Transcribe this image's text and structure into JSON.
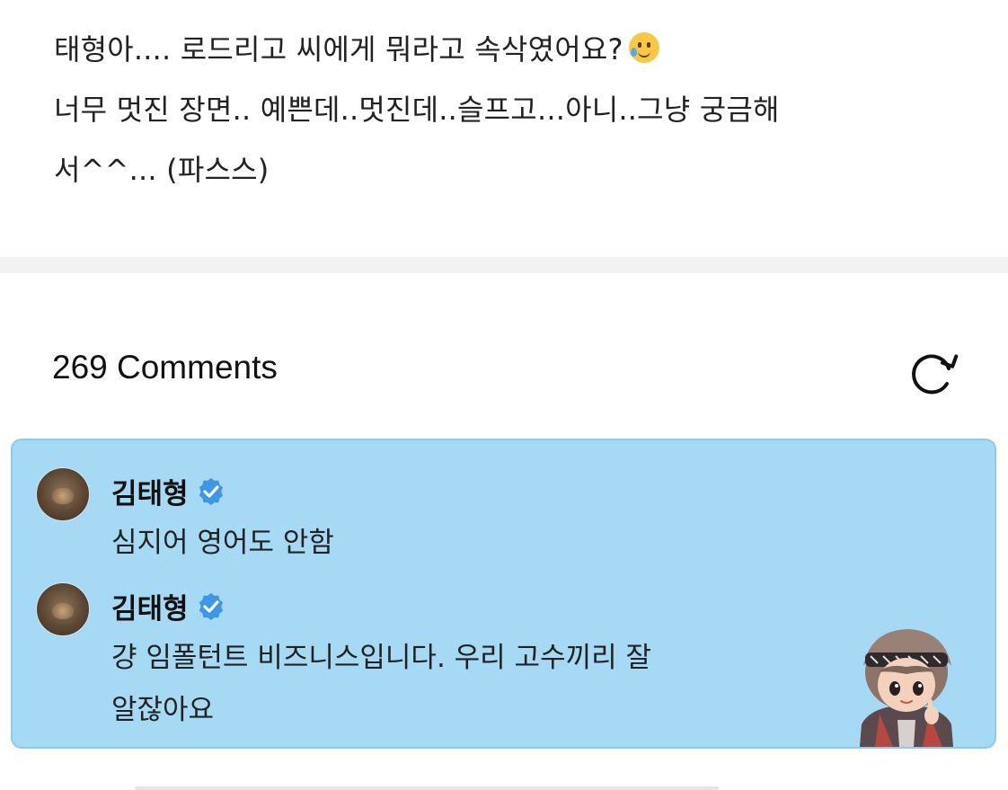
{
  "post": {
    "lines": [
      "태형아.... 로드리고 씨에게 뭐라고 속삭였어요?",
      "너무 멋진 장면.. 예쁜데..멋진데..슬프고...아니..그냥 궁금해",
      "서^^... (파스스)"
    ],
    "emoji": "smiling-face-with-tear-icon"
  },
  "comments_section": {
    "header": "269 Comments",
    "refresh_icon": "refresh-icon"
  },
  "highlight": {
    "background_color": "#a6daf4",
    "comments": [
      {
        "author": "김태형",
        "verified": true,
        "lines": [
          "심지어 영어도 안함"
        ]
      },
      {
        "author": "김태형",
        "verified": true,
        "lines": [
          "걍 임폴턴트 비즈니스입니다. 우리 고수끼리 잘",
          "알잖아요"
        ]
      }
    ]
  },
  "colors": {
    "verified_badge": "#3d96e8",
    "text": "#222222"
  }
}
